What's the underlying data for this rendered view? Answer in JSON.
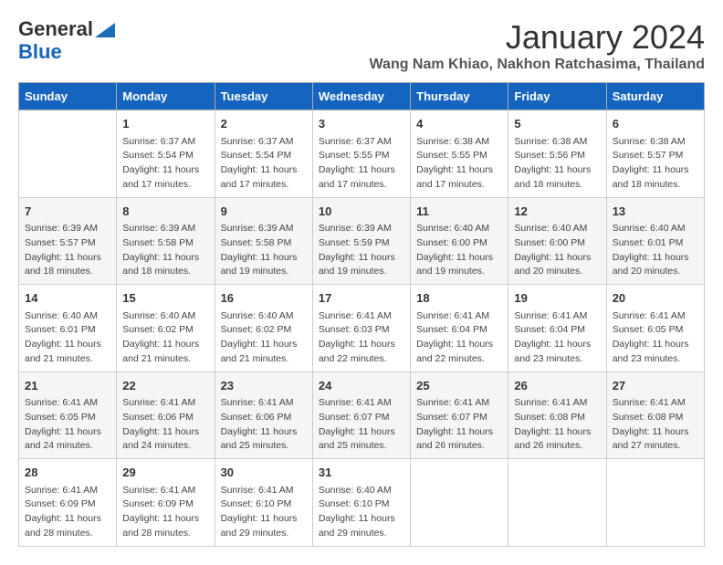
{
  "header": {
    "logo_line1": "General",
    "logo_line2": "Blue",
    "main_title": "January 2024",
    "subtitle": "Wang Nam Khiao, Nakhon Ratchasima, Thailand"
  },
  "days_of_week": [
    "Sunday",
    "Monday",
    "Tuesday",
    "Wednesday",
    "Thursday",
    "Friday",
    "Saturday"
  ],
  "weeks": [
    [
      {
        "num": "",
        "info": ""
      },
      {
        "num": "1",
        "info": "Sunrise: 6:37 AM\nSunset: 5:54 PM\nDaylight: 11 hours\nand 17 minutes."
      },
      {
        "num": "2",
        "info": "Sunrise: 6:37 AM\nSunset: 5:54 PM\nDaylight: 11 hours\nand 17 minutes."
      },
      {
        "num": "3",
        "info": "Sunrise: 6:37 AM\nSunset: 5:55 PM\nDaylight: 11 hours\nand 17 minutes."
      },
      {
        "num": "4",
        "info": "Sunrise: 6:38 AM\nSunset: 5:55 PM\nDaylight: 11 hours\nand 17 minutes."
      },
      {
        "num": "5",
        "info": "Sunrise: 6:38 AM\nSunset: 5:56 PM\nDaylight: 11 hours\nand 18 minutes."
      },
      {
        "num": "6",
        "info": "Sunrise: 6:38 AM\nSunset: 5:57 PM\nDaylight: 11 hours\nand 18 minutes."
      }
    ],
    [
      {
        "num": "7",
        "info": "Sunrise: 6:39 AM\nSunset: 5:57 PM\nDaylight: 11 hours\nand 18 minutes."
      },
      {
        "num": "8",
        "info": "Sunrise: 6:39 AM\nSunset: 5:58 PM\nDaylight: 11 hours\nand 18 minutes."
      },
      {
        "num": "9",
        "info": "Sunrise: 6:39 AM\nSunset: 5:58 PM\nDaylight: 11 hours\nand 19 minutes."
      },
      {
        "num": "10",
        "info": "Sunrise: 6:39 AM\nSunset: 5:59 PM\nDaylight: 11 hours\nand 19 minutes."
      },
      {
        "num": "11",
        "info": "Sunrise: 6:40 AM\nSunset: 6:00 PM\nDaylight: 11 hours\nand 19 minutes."
      },
      {
        "num": "12",
        "info": "Sunrise: 6:40 AM\nSunset: 6:00 PM\nDaylight: 11 hours\nand 20 minutes."
      },
      {
        "num": "13",
        "info": "Sunrise: 6:40 AM\nSunset: 6:01 PM\nDaylight: 11 hours\nand 20 minutes."
      }
    ],
    [
      {
        "num": "14",
        "info": "Sunrise: 6:40 AM\nSunset: 6:01 PM\nDaylight: 11 hours\nand 21 minutes."
      },
      {
        "num": "15",
        "info": "Sunrise: 6:40 AM\nSunset: 6:02 PM\nDaylight: 11 hours\nand 21 minutes."
      },
      {
        "num": "16",
        "info": "Sunrise: 6:40 AM\nSunset: 6:02 PM\nDaylight: 11 hours\nand 21 minutes."
      },
      {
        "num": "17",
        "info": "Sunrise: 6:41 AM\nSunset: 6:03 PM\nDaylight: 11 hours\nand 22 minutes."
      },
      {
        "num": "18",
        "info": "Sunrise: 6:41 AM\nSunset: 6:04 PM\nDaylight: 11 hours\nand 22 minutes."
      },
      {
        "num": "19",
        "info": "Sunrise: 6:41 AM\nSunset: 6:04 PM\nDaylight: 11 hours\nand 23 minutes."
      },
      {
        "num": "20",
        "info": "Sunrise: 6:41 AM\nSunset: 6:05 PM\nDaylight: 11 hours\nand 23 minutes."
      }
    ],
    [
      {
        "num": "21",
        "info": "Sunrise: 6:41 AM\nSunset: 6:05 PM\nDaylight: 11 hours\nand 24 minutes."
      },
      {
        "num": "22",
        "info": "Sunrise: 6:41 AM\nSunset: 6:06 PM\nDaylight: 11 hours\nand 24 minutes."
      },
      {
        "num": "23",
        "info": "Sunrise: 6:41 AM\nSunset: 6:06 PM\nDaylight: 11 hours\nand 25 minutes."
      },
      {
        "num": "24",
        "info": "Sunrise: 6:41 AM\nSunset: 6:07 PM\nDaylight: 11 hours\nand 25 minutes."
      },
      {
        "num": "25",
        "info": "Sunrise: 6:41 AM\nSunset: 6:07 PM\nDaylight: 11 hours\nand 26 minutes."
      },
      {
        "num": "26",
        "info": "Sunrise: 6:41 AM\nSunset: 6:08 PM\nDaylight: 11 hours\nand 26 minutes."
      },
      {
        "num": "27",
        "info": "Sunrise: 6:41 AM\nSunset: 6:08 PM\nDaylight: 11 hours\nand 27 minutes."
      }
    ],
    [
      {
        "num": "28",
        "info": "Sunrise: 6:41 AM\nSunset: 6:09 PM\nDaylight: 11 hours\nand 28 minutes."
      },
      {
        "num": "29",
        "info": "Sunrise: 6:41 AM\nSunset: 6:09 PM\nDaylight: 11 hours\nand 28 minutes."
      },
      {
        "num": "30",
        "info": "Sunrise: 6:41 AM\nSunset: 6:10 PM\nDaylight: 11 hours\nand 29 minutes."
      },
      {
        "num": "31",
        "info": "Sunrise: 6:40 AM\nSunset: 6:10 PM\nDaylight: 11 hours\nand 29 minutes."
      },
      {
        "num": "",
        "info": ""
      },
      {
        "num": "",
        "info": ""
      },
      {
        "num": "",
        "info": ""
      }
    ]
  ]
}
